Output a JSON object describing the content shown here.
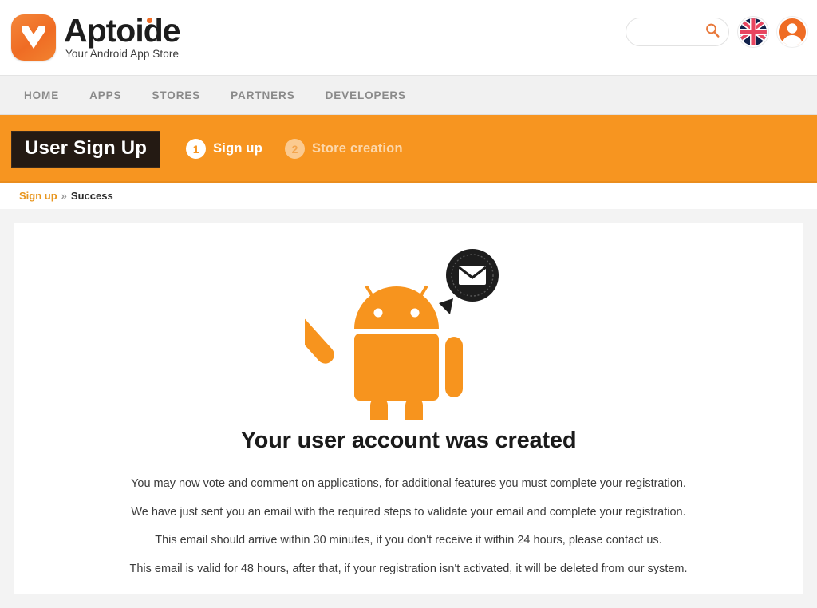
{
  "header": {
    "brand_name": "Aptoide",
    "brand_tagline": "Your Android App Store",
    "logo_icon": "aptoide-logo-icon",
    "search": {
      "value": "",
      "placeholder": "",
      "icon": "search-icon"
    },
    "language_flag": {
      "icon": "uk-flag-icon",
      "label": "English"
    },
    "account_avatar": {
      "icon": "user-avatar-icon"
    }
  },
  "nav": {
    "items": [
      {
        "label": "HOME"
      },
      {
        "label": "APPS"
      },
      {
        "label": "STORES"
      },
      {
        "label": "PARTNERS"
      },
      {
        "label": "DEVELOPERS"
      }
    ]
  },
  "stepbar": {
    "title": "User Sign Up",
    "steps": [
      {
        "number": "1",
        "label": "Sign up",
        "state": "active"
      },
      {
        "number": "2",
        "label": "Store creation",
        "state": "inactive"
      }
    ]
  },
  "breadcrumb": {
    "link": "Sign up",
    "separator": "»",
    "current": "Success"
  },
  "main": {
    "illustration": {
      "robot_icon": "android-robot-icon",
      "bubble_icon": "email-envelope-bubble-icon"
    },
    "title": "Your user account was created",
    "messages": [
      "You may now vote and comment on applications, for additional features you must complete your registration.",
      "We have just sent you an email with the required steps to validate your email and complete your registration.",
      "This email should arrive within 30 minutes, if you don't receive it within 24 hours, please contact us.",
      "This email is valid for 48 hours, after that, if your registration isn't activated, it will be deleted from our system."
    ]
  },
  "colors": {
    "brand_orange": "#f79520",
    "logo_orange": "#ef6c24",
    "android_orange": "#f7941e",
    "dark_badge": "#241a13",
    "nav_text": "#8a8a8a"
  }
}
